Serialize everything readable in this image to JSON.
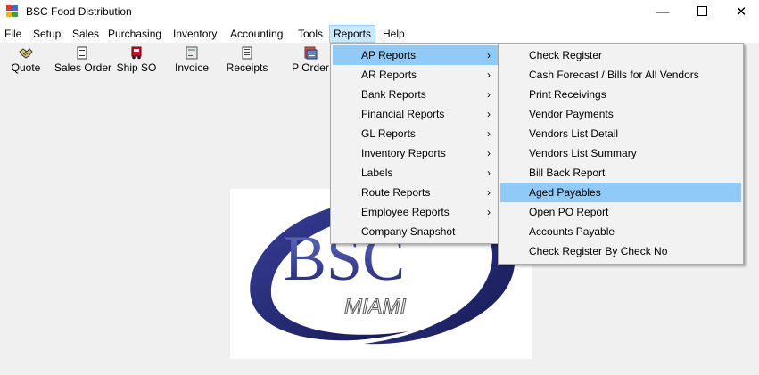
{
  "window": {
    "title": "BSC Food Distribution",
    "min_glyph": "—",
    "close_glyph": "✕"
  },
  "menubar": {
    "items": [
      "File",
      "Setup",
      "Sales",
      "Purchasing",
      "Inventory",
      "Accounting",
      "Tools",
      "Reports",
      "Help"
    ],
    "active": "Reports"
  },
  "toolbar": {
    "items": [
      {
        "label": "Quote",
        "icon": "handshake-icon"
      },
      {
        "label": "Sales Order",
        "icon": "document-icon"
      },
      {
        "label": "Ship SO",
        "icon": "truck-icon"
      },
      {
        "label": "Invoice",
        "icon": "invoice-icon"
      },
      {
        "label": "Receipts",
        "icon": "receipt-icon"
      },
      {
        "label": "P Order",
        "icon": "purchase-order-icon"
      }
    ]
  },
  "reports_menu": {
    "items": [
      {
        "label": "AP Reports",
        "has_submenu": true,
        "highlighted": true
      },
      {
        "label": "AR Reports",
        "has_submenu": true
      },
      {
        "label": "Bank Reports",
        "has_submenu": true
      },
      {
        "label": "Financial Reports",
        "has_submenu": true
      },
      {
        "label": "GL Reports",
        "has_submenu": true
      },
      {
        "label": "Inventory Reports",
        "has_submenu": true
      },
      {
        "label": "Labels",
        "has_submenu": true
      },
      {
        "label": "Route Reports",
        "has_submenu": true
      },
      {
        "label": "Employee Reports",
        "has_submenu": true
      },
      {
        "label": "Company Snapshot",
        "has_submenu": false
      }
    ],
    "arrow_glyph": "›"
  },
  "ap_reports_menu": {
    "items": [
      {
        "label": "Check Register"
      },
      {
        "label": "Cash Forecast / Bills for All Vendors"
      },
      {
        "label": "Print Receivings"
      },
      {
        "label": "Vendor Payments"
      },
      {
        "label": "Vendors List Detail"
      },
      {
        "label": "Vendors List Summary"
      },
      {
        "label": "Bill Back Report"
      },
      {
        "label": "Aged Payables",
        "highlighted": true
      },
      {
        "label": "Open PO Report"
      },
      {
        "label": "Accounts Payable"
      },
      {
        "label": "Check Register By Check No"
      }
    ]
  },
  "logo": {
    "main_text": "BSC",
    "sub_text": "MIAMI"
  },
  "colors": {
    "menu_highlight": "#91c9f7",
    "active_menu_bg": "#cce8ff",
    "logo_navy": "#1e2470"
  }
}
